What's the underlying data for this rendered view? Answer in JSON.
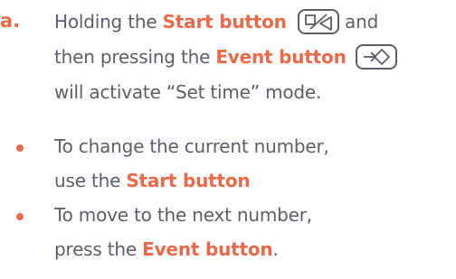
{
  "step": {
    "marker": "a.",
    "line1": {
      "pre": "Holding the ",
      "highlight": "Start button",
      "post": "and"
    },
    "line2": {
      "pre": "then pressing the ",
      "highlight": "Event button"
    },
    "line3": "will activate “Set time” mode.",
    "start_icon": "start-split-triangle-icon",
    "event_icon": "event-arrow-diamond-icon"
  },
  "bullets": [
    {
      "line1": "To change the current number,",
      "pre": "use the ",
      "highlight": "Start button",
      "post": ""
    },
    {
      "line1": "To move to the next number,",
      "pre": "press the ",
      "highlight": "Event button",
      "post": "."
    }
  ],
  "colors": {
    "accent": "#e86a4a",
    "text": "#5c5e68"
  }
}
